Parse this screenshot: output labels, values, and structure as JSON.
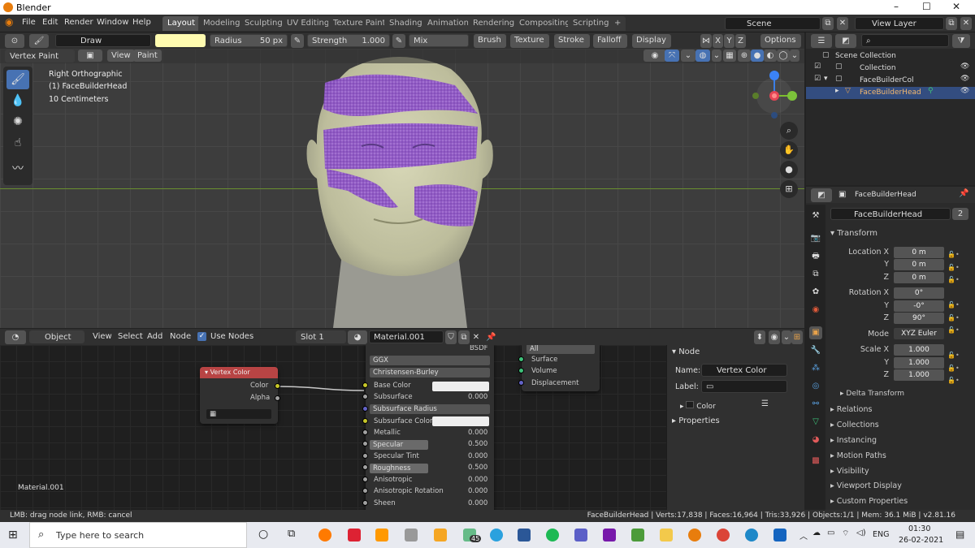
{
  "window": {
    "title": "Blender",
    "controls": [
      "–",
      "☐",
      "✕"
    ]
  },
  "menu": {
    "items": [
      "File",
      "Edit",
      "Render",
      "Window",
      "Help"
    ]
  },
  "workspaces": {
    "tabs": [
      "Layout",
      "Modeling",
      "Sculpting",
      "UV Editing",
      "Texture Paint",
      "Shading",
      "Animation",
      "Rendering",
      "Compositing",
      "Scripting"
    ],
    "active": "Layout",
    "add": "+"
  },
  "scene": {
    "label": "Scene",
    "view_layer": "View Layer"
  },
  "tool_header": {
    "brush": "Draw",
    "radius_label": "Radius",
    "radius_value": "50 px",
    "strength_label": "Strength",
    "strength_value": "1.000",
    "blend": "Mix",
    "menus": [
      "Brush",
      "Texture",
      "Stroke",
      "Falloff",
      "Display"
    ],
    "axes": [
      "X",
      "Y",
      "Z"
    ],
    "options": "Options"
  },
  "viewport": {
    "mode": "Vertex Paint",
    "view_menu": "View",
    "paint_menu": "Paint",
    "overlay_text": [
      "Right Orthographic",
      "(1) FaceBuilderHead",
      "10 Centimeters"
    ]
  },
  "outliner": {
    "rows": [
      "Scene Collection",
      "Collection",
      "FaceBuilderCol",
      "FaceBuilderHead"
    ]
  },
  "properties": {
    "object_name": "FaceBuilderHead",
    "data_name": "FaceBuilderHead",
    "users": "2",
    "transform_label": "Transform",
    "location": {
      "label": "Location X",
      "y": "Y",
      "z": "Z",
      "values": [
        "0 m",
        "0 m",
        "0 m"
      ]
    },
    "rotation": {
      "label": "Rotation X",
      "y": "Y",
      "z": "Z",
      "values": [
        "0°",
        "-0°",
        "90°"
      ]
    },
    "mode_label": "Mode",
    "mode_value": "XYZ Euler",
    "scale": {
      "label": "Scale X",
      "y": "Y",
      "z": "Z",
      "values": [
        "1.000",
        "1.000",
        "1.000"
      ]
    },
    "sections": [
      "Delta Transform",
      "Relations",
      "Collections",
      "Instancing",
      "Motion Paths",
      "Visibility",
      "Viewport Display",
      "Custom Properties"
    ]
  },
  "node_editor": {
    "type": "Object",
    "menus": [
      "View",
      "Select",
      "Add",
      "Node"
    ],
    "use_nodes": "Use Nodes",
    "slot": "Slot 1",
    "material": "Material.001",
    "material_footer": "Material.001",
    "vertex_node": {
      "title": "Vertex Color",
      "outputs": [
        "Color",
        "Alpha"
      ]
    },
    "bsdf": {
      "title": "BSDF",
      "dist": "GGX",
      "sss_method": "Christensen-Burley",
      "rows": [
        {
          "label": "Base Color",
          "value": ""
        },
        {
          "label": "Subsurface",
          "value": "0.000"
        },
        {
          "label": "Subsurface Radius",
          "value": ""
        },
        {
          "label": "Subsurface Color",
          "value": ""
        },
        {
          "label": "Metallic",
          "value": "0.000"
        },
        {
          "label": "Specular",
          "value": "0.500"
        },
        {
          "label": "Specular Tint",
          "value": "0.000"
        },
        {
          "label": "Roughness",
          "value": "0.500"
        },
        {
          "label": "Anisotropic",
          "value": "0.000"
        },
        {
          "label": "Anisotropic Rotation",
          "value": "0.000"
        },
        {
          "label": "Sheen",
          "value": "0.000"
        }
      ]
    },
    "output_node": {
      "target": "All",
      "inputs": [
        "Surface",
        "Volume",
        "Displacement"
      ]
    },
    "sidebar": {
      "node_section": "Node",
      "name_label": "Name:",
      "name_value": "Vertex Color",
      "label_label": "Label:",
      "color_label": "Color",
      "properties": "Properties"
    }
  },
  "status": {
    "left": "LMB: drag node link, RMB: cancel",
    "right": "FaceBuilderHead | Verts:17,838 | Faces:16,964 | Tris:33,926 | Objects:1/1 | Mem: 36.1 MiB | v2.81.16"
  },
  "taskbar": {
    "search": "Type here to search",
    "lang": "ENG",
    "time": "01:30",
    "date": "26-02-2021",
    "badge": "45"
  },
  "colors": {
    "accent": "#4772b3",
    "paint": "#8b55c8",
    "head": "#c8c8a6"
  }
}
